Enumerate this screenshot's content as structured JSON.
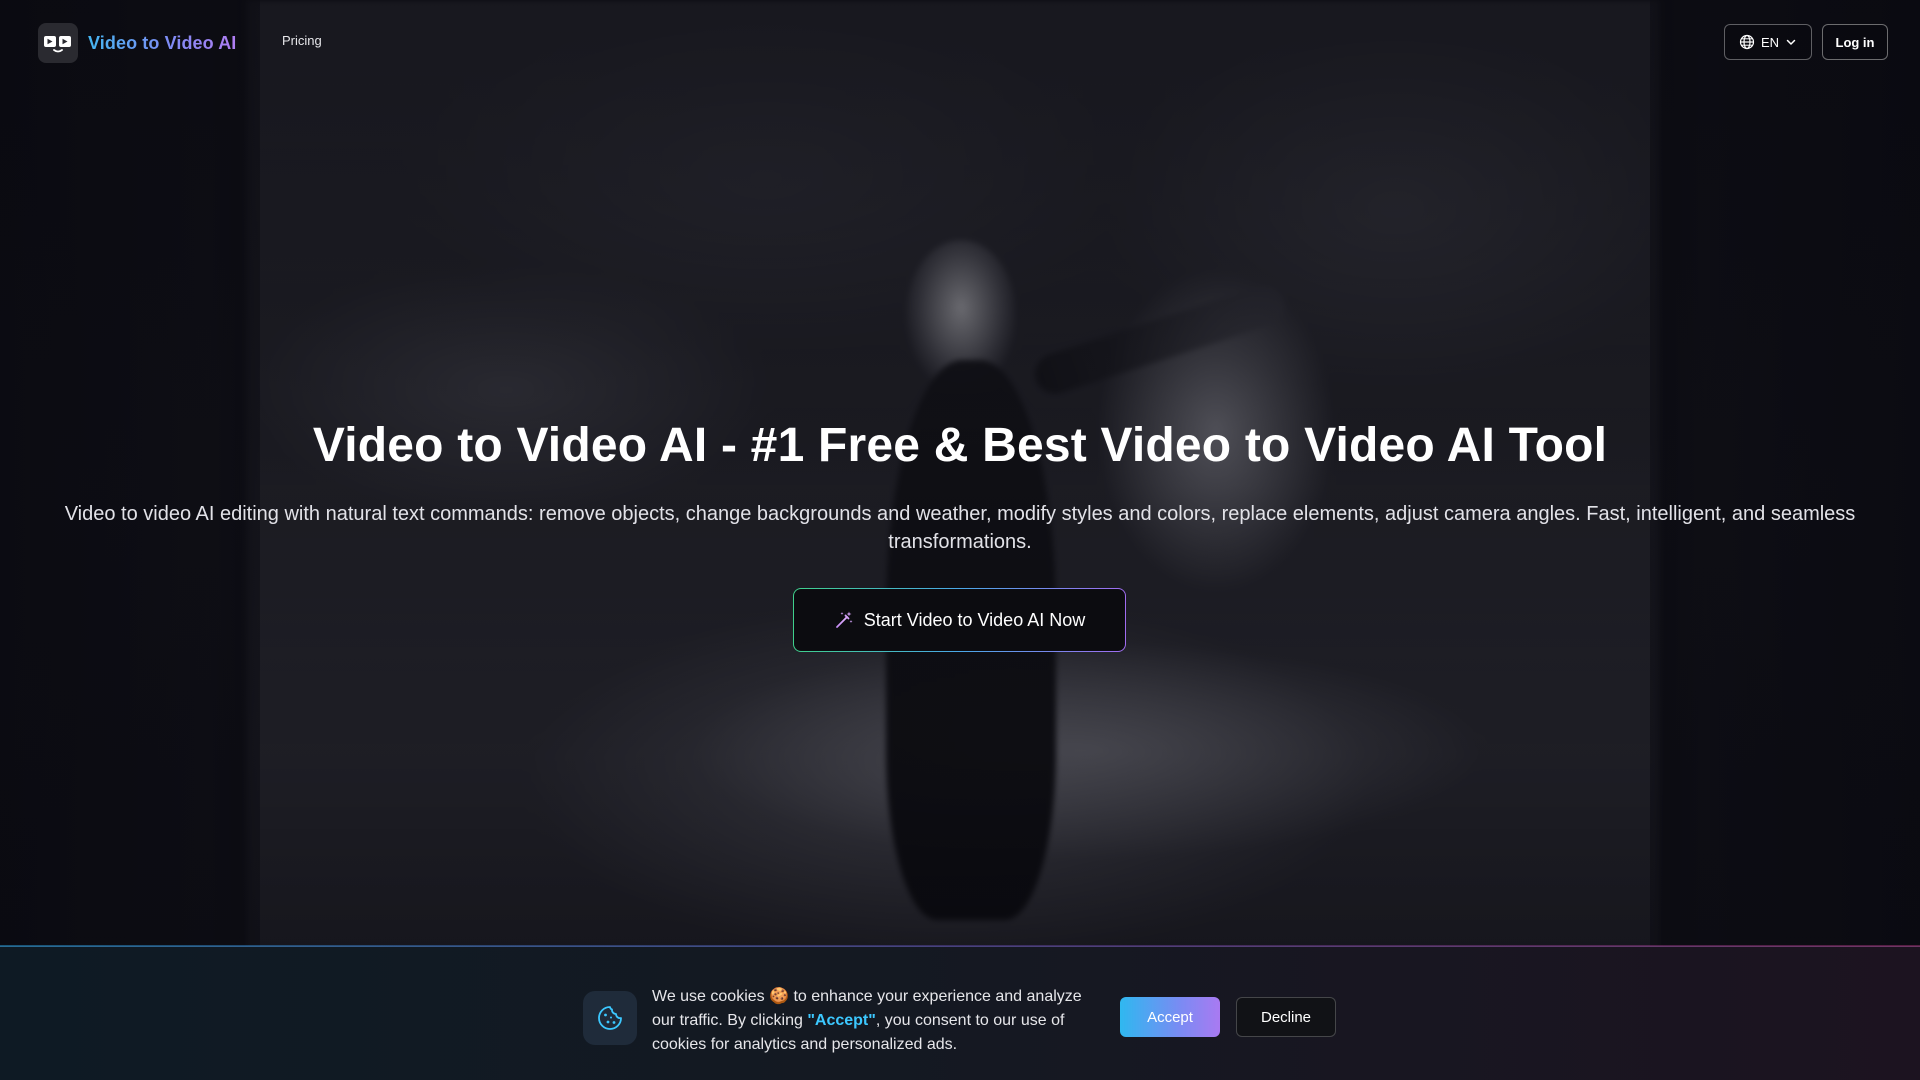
{
  "header": {
    "brand_name": "Video to Video AI",
    "nav": {
      "pricing": "Pricing"
    },
    "language": "EN",
    "login_label": "Log in"
  },
  "hero": {
    "title": "Video to Video AI - #1 Free & Best Video to Video AI Tool",
    "subtitle": "Video to video AI editing with natural text commands: remove objects, change backgrounds and weather, modify styles and colors, replace elements, adjust camera angles. Fast, intelligent, and seamless transformations.",
    "cta_label": "Start Video to Video AI Now"
  },
  "cookie_banner": {
    "text_before": "We use cookies 🍪 to enhance your experience and analyze our traffic. By clicking ",
    "text_highlight": "\"Accept\"",
    "text_after": ", you consent to our use of cookies for analytics and personalized ads.",
    "accept_label": "Accept",
    "decline_label": "Decline"
  },
  "icons": {
    "brand": "video-logo-icon",
    "language": "globe-icon",
    "language_dropdown": "chevron-down-icon",
    "cta": "magic-wand-icon",
    "cookie": "cookie-icon"
  },
  "colors": {
    "brand_gradient_start": "#45b6f2",
    "brand_gradient_end": "#b07df3",
    "accept_gradient_start": "#2fb8f0",
    "accept_gradient_end": "#a97af2",
    "cookie_highlight": "#3cc8ff",
    "cta_border_start": "#3fd08c",
    "cta_border_end": "#a06cf0"
  }
}
